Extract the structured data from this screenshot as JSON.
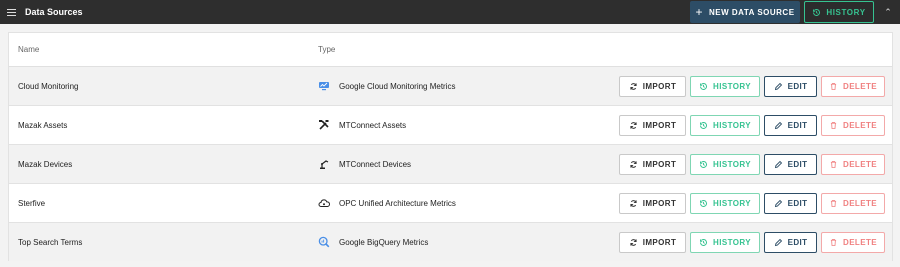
{
  "header": {
    "title": "Data Sources",
    "new_button": "NEW DATA SOURCE",
    "history_button": "HISTORY"
  },
  "table": {
    "columns": [
      "Name",
      "Type"
    ],
    "rows": [
      {
        "name": "Cloud Monitoring",
        "type": "Google Cloud Monitoring Metrics",
        "icon": "cloud-monitoring-icon"
      },
      {
        "name": "Mazak Assets",
        "type": "MTConnect Assets",
        "icon": "tools-icon"
      },
      {
        "name": "Mazak Devices",
        "type": "MTConnect Devices",
        "icon": "robot-arm-icon"
      },
      {
        "name": "Sterfive",
        "type": "OPC Unified Architecture Metrics",
        "icon": "cloud-gear-icon"
      },
      {
        "name": "Top Search Terms",
        "type": "Google BigQuery Metrics",
        "icon": "bigquery-icon"
      }
    ]
  },
  "actions": {
    "import": "IMPORT",
    "history": "HISTORY",
    "edit": "EDIT",
    "delete": "DELETE"
  },
  "colors": {
    "topbar": "#2e2e2e",
    "primary": "#2d4d66",
    "history_green": "#36c391",
    "delete_red": "#f08080"
  }
}
